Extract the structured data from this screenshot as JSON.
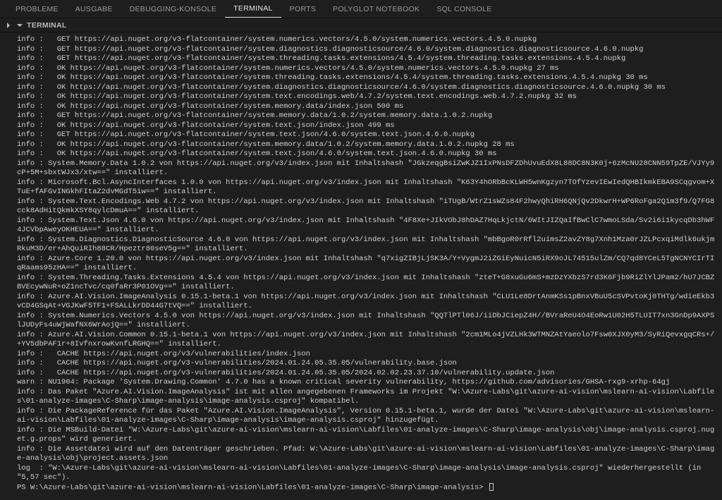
{
  "tabs": {
    "problems": "PROBLEME",
    "output": "AUSGABE",
    "debug": "DEBUGGING-KONSOLE",
    "terminal": "TERMINAL",
    "ports": "PORTS",
    "polyglot": "POLYGLOT NOTEBOOK",
    "sql": "SQL CONSOLE"
  },
  "panel": {
    "title": "TERMINAL"
  },
  "terminal": {
    "lines": [
      "info :   GET https://api.nuget.org/v3-flatcontainer/system.numerics.vectors/4.5.0/system.numerics.vectors.4.5.0.nupkg",
      "info :   GET https://api.nuget.org/v3-flatcontainer/system.diagnostics.diagnosticsource/4.6.0/system.diagnostics.diagnosticsource.4.6.0.nupkg",
      "info :   GET https://api.nuget.org/v3-flatcontainer/system.threading.tasks.extensions/4.5.4/system.threading.tasks.extensions.4.5.4.nupkg",
      "info :   OK https://api.nuget.org/v3-flatcontainer/system.numerics.vectors/4.5.0/system.numerics.vectors.4.5.0.nupkg 27 ms",
      "info :   OK https://api.nuget.org/v3-flatcontainer/system.threading.tasks.extensions/4.5.4/system.threading.tasks.extensions.4.5.4.nupkg 30 ms",
      "info :   OK https://api.nuget.org/v3-flatcontainer/system.diagnostics.diagnosticsource/4.6.0/system.diagnostics.diagnosticsource.4.6.0.nupkg 30 ms",
      "info :   OK https://api.nuget.org/v3-flatcontainer/system.text.encodings.web/4.7.2/system.text.encodings.web.4.7.2.nupkg 32 ms",
      "info :   OK https://api.nuget.org/v3-flatcontainer/system.memory.data/index.json 500 ms",
      "info :   GET https://api.nuget.org/v3-flatcontainer/system.memory.data/1.0.2/system.memory.data.1.0.2.nupkg",
      "info :   OK https://api.nuget.org/v3-flatcontainer/system.text.json/index.json 499 ms",
      "info :   GET https://api.nuget.org/v3-flatcontainer/system.text.json/4.6.0/system.text.json.4.6.0.nupkg",
      "info :   OK https://api.nuget.org/v3-flatcontainer/system.memory.data/1.0.2/system.memory.data.1.0.2.nupkg 28 ms",
      "info :   OK https://api.nuget.org/v3-flatcontainer/system.text.json/4.6.0/system.text.json.4.6.0.nupkg 30 ms",
      "info : System.Memory.Data 1.0.2 von https://api.nuget.org/v3/index.json mit Inhaltshash \"JGkzeqgBsiZwKJZ1IxPNsDFZDhUvuEdX8L88DC8N3K0j+6zMcNU28CNN59TpZE/VJYy9cP+5M+sbxtWJx3/xtw==\" installiert.",
      "info : Microsoft.Bcl.AsyncInterfaces 1.0.0 von https://api.nuget.org/v3/index.json mit Inhaltshash \"K63Y4hORbBcKLWH5wnKgzyn7TOfYzevIEwIedQHBIkmkEBA9SCqgvom+XTuE+fAFGvINGkhFItaZ2dvMGdT5iw==\" installiert.",
      "info : System.Text.Encodings.Web 4.7.2 von https://api.nuget.org/v3/index.json mit Inhaltshash \"iTUgB/WtrZ1sWZs84F2hwyQhiRH6QNjQv2DkwrH+WP6RoFga2Q1m3f9/Q7FG8cck8AdHitQkmkXSY8qylcDmuA==\" installiert.",
      "info : System.Text.Json 4.6.0 von https://api.nuget.org/v3/index.json mit Inhaltshash \"4F8Xe+JIkVObJ8hDAZ7HqLkjctN/6WItJIZQaIfBwClC7wmoLSda/Sv2i6i1kycqDb3hWF4JCVbpAweyOKHEUA==\" installiert.",
      "info : System.Diagnostics.DiagnosticSource 4.6.0 von https://api.nuget.org/v3/index.json mit Inhaltshash \"mbBgoR0rRfl2uimsZ2avZY8g7Xnh1Mza0rJZLPcxqiMdlk6ukjmRkuM3D/er+AhQuiRIh88CR/Hpeztr80seV5g==\" installiert.",
      "info : Azure.Core 1.20.0 von https://api.nuget.org/v3/index.json mit Inhaltshash \"q7xigZIBjLjSK3A/Y+VygmJ2iZGiEyNuicN5iRX9oJL74515ulZm/CQ7qd8YCeL5TgNCNYCIrTIqRaams95zHA==\" installiert.",
      "info : System.Threading.Tasks.Extensions 4.5.4 von https://api.nuget.org/v3/index.json mit Inhaltshash \"zteT+G8xuGu6mS+mzDzYXbzS7rd3K6Fjb9RiZlYlJPam2/hU7JCBZBVEcywNuR+oZ1ncTvc/cq0faRr3P01OVg==\" installiert.",
      "info : Azure.AI.Vision.ImageAnalysis 0.15.1-beta.1 von https://api.nuget.org/v3/index.json mit Inhaltshash \"CLU1Le8DrtAnmKSs1pBnxVBuU5cSVPvtoKj0THTg/wdieEkb3vCD4GSqAt+VGJKwF5TF1+FSALLkrDD44G7tVQ==\" installiert.",
      "info : System.Numerics.Vectors 4.5.0 von https://api.nuget.org/v3/index.json mit Inhaltshash \"QQTlPTl06J/iiDbJCiepZ4H//BVraReU4O4EoRw1U02H5TLUIT7xn3GnDp9AXPSlJUDyFs4uWjWafNX6WrAojQ==\" installiert.",
      "info : Azure.AI.Vision.Common 0.15.1-beta.1 von https://api.nuget.org/v3/index.json mit Inhaltshash \"2cm1MLo4jVZLHk3WTMNZAtYaeolo7Fsw0XJX0yM3/SyRiQevxgqCRs+/+YV5dbPAF1r+8IvfnxrowKvnfLRGHQ==\" installiert.",
      "info :   CACHE https://api.nuget.org/v3/vulnerabilities/index.json",
      "info :   CACHE https://api.nuget.org/v3-vulnerabilities/2024.01.24.05.35.05/vulnerability.base.json",
      "info :   CACHE https://api.nuget.org/v3-vulnerabilities/2024.01.24.05.35.05/2024.02.02.23.37.10/vulnerability.update.json",
      "warn : NU1904: Package 'System.Drawing.Common' 4.7.0 has a known critical severity vulnerability, https://github.com/advisories/GHSA-rxg9-xrhp-64gj",
      "info : Das Paket \"Azure.AI.Vision.ImageAnalysis\" ist mit allen angegebenen Frameworks im Projekt \"W:\\Azure-Labs\\git\\azure-ai-vision\\mslearn-ai-vision\\Labfiles\\01-analyze-images\\C-Sharp\\image-analysis\\image-analysis.csproj\" kompatibel.",
      "info : Die PackageReference für das Paket \"Azure.AI.Vision.ImageAnalysis\", Version 0.15.1-beta.1, wurde der Datei \"W:\\Azure-Labs\\git\\azure-ai-vision\\mslearn-ai-vision\\Labfiles\\01-analyze-images\\C-Sharp\\image-analysis\\image-analysis.csproj\" hinzugefügt.",
      "info : Die MSBuild-Datei \"W:\\Azure-Labs\\git\\azure-ai-vision\\mslearn-ai-vision\\Labfiles\\01-analyze-images\\C-Sharp\\image-analysis\\obj\\image-analysis.csproj.nuget.g.props\" wird generiert.",
      "info : Die Assetdatei wird auf den Datenträger geschrieben. Pfad: W:\\Azure-Labs\\git\\azure-ai-vision\\mslearn-ai-vision\\Labfiles\\01-analyze-images\\C-Sharp\\image-analysis\\obj\\project.assets.json",
      "log  : \"W:\\Azure-Labs\\git\\azure-ai-vision\\mslearn-ai-vision\\Labfiles\\01-analyze-images\\C-Sharp\\image-analysis\\image-analysis.csproj\" wiederhergestellt (in \"5,57 sec\")."
    ],
    "prompt": "PS W:\\Azure-Labs\\git\\azure-ai-vision\\mslearn-ai-vision\\Labfiles\\01-analyze-images\\C-Sharp\\image-analysis> "
  }
}
